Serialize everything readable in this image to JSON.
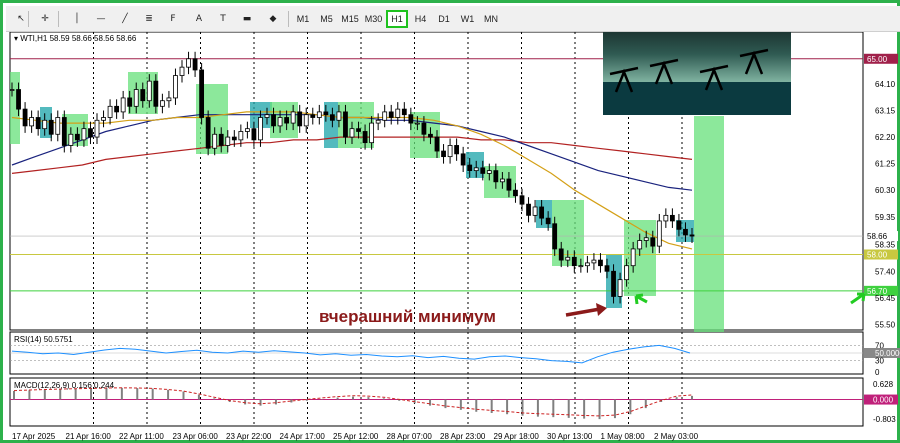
{
  "toolbar": {
    "icons": [
      "cursor-icon",
      "crosshair-icon",
      "vertical-line-icon",
      "horizontal-line-icon",
      "trend-line-icon",
      "channel-icon",
      "fibonacci-icon",
      "text-icon",
      "label-icon",
      "rectangle-icon",
      "shapes-icon"
    ],
    "timeframes": [
      "M1",
      "M5",
      "M15",
      "M30",
      "H1",
      "H4",
      "D1",
      "W1",
      "MN"
    ],
    "active_timeframe": "H1"
  },
  "header": {
    "symbol": "WTI,H1",
    "ohlc": "58.59 58.66 58.56 58.66"
  },
  "annotation": {
    "text": "вчерашний минимум",
    "color": "#8b1a1a"
  },
  "colors": {
    "bull": "#000000",
    "bear": "#000000",
    "zone_green": "#66e07a",
    "zone_teal": "#1aa3a8",
    "ma_fast": "#d4a017",
    "ma_mid": "#1a237e",
    "ma_slow": "#b22222",
    "resistance": "#a0204a",
    "level_yellow": "#c8c840",
    "level_green": "#3fd13f",
    "rsi_line": "#1e90ff",
    "macd_hist": "#808080",
    "macd_signal": "#cc2222"
  },
  "chart_data": [
    {
      "type": "line",
      "name": "price",
      "x_labels": [
        "17 Apr 2025",
        "21 Apr 16:00",
        "22 Apr 11:00",
        "23 Apr 06:00",
        "23 Apr 22:00",
        "24 Apr 17:00",
        "25 Apr 12:00",
        "28 Apr 07:00",
        "28 Apr 23:00",
        "29 Apr 18:00",
        "30 Apr 13:00",
        "1 May 08:00",
        "2 May 03:00"
      ],
      "y_ticks": [
        64.1,
        63.15,
        62.2,
        61.25,
        60.3,
        59.35,
        58.35,
        57.4,
        56.45,
        55.5
      ],
      "ylim": [
        55.3,
        65.6
      ],
      "levels": [
        {
          "value": 65.0,
          "label": "65.00",
          "color": "#a0204a"
        },
        {
          "value": 58.0,
          "label": "58.00",
          "color": "#c8c840"
        },
        {
          "value": 56.7,
          "label": "56.70",
          "color": "#3fd13f"
        },
        {
          "value": 58.66,
          "label": "58.66",
          "color": "#000000"
        }
      ],
      "candles": [
        63.9,
        63.2,
        62.6,
        62.9,
        62.5,
        62.8,
        62.3,
        62.9,
        61.9,
        62.3,
        62.1,
        62.5,
        62.2,
        62.8,
        62.9,
        63.3,
        63.1,
        63.6,
        63.3,
        63.9,
        63.5,
        64.2,
        63.3,
        63.5,
        63.6,
        64.4,
        64.7,
        65.0,
        64.6,
        62.9,
        61.8,
        62.3,
        61.9,
        62.2,
        62.1,
        62.4,
        62.5,
        62.1,
        62.9,
        63.0,
        62.6,
        62.9,
        62.7,
        63.1,
        62.6,
        63.0,
        62.9,
        63.1,
        63.0,
        62.8,
        63.1,
        62.2,
        62.5,
        62.4,
        62.0,
        62.7,
        62.8,
        63.1,
        62.9,
        63.2,
        63.0,
        62.7,
        62.7,
        62.3,
        62.2,
        61.7,
        61.5,
        61.9,
        61.6,
        61.2,
        61.0,
        61.1,
        60.9,
        61.0,
        60.6,
        60.7,
        60.3,
        60.1,
        59.8,
        59.4,
        59.7,
        59.3,
        59.1,
        58.2,
        57.8,
        57.9,
        57.6,
        57.6,
        57.7,
        57.8,
        57.6,
        57.4,
        56.5,
        57.1,
        57.6,
        58.2,
        58.5,
        58.6,
        58.3,
        59.2,
        59.4,
        59.2,
        58.9,
        58.7,
        58.66
      ],
      "ma_fast": [
        62.9,
        62.8,
        62.7,
        62.7,
        62.7,
        62.8,
        62.8,
        62.9,
        62.9,
        63.0,
        63.1,
        63.1,
        63.1,
        63.0,
        62.9,
        62.9,
        62.9,
        62.9,
        62.8,
        62.6,
        62.3,
        61.9,
        61.4,
        60.9,
        60.3,
        59.8,
        59.3,
        58.8,
        58.4,
        58.2
      ],
      "ma_mid": [
        61.2,
        61.5,
        61.8,
        62.1,
        62.4,
        62.6,
        62.8,
        62.9,
        63.0,
        63.0,
        63.0,
        63.0,
        63.0,
        63.0,
        62.9,
        62.9,
        62.8,
        62.8,
        62.7,
        62.6,
        62.4,
        62.2,
        61.9,
        61.6,
        61.3,
        61.0,
        60.8,
        60.6,
        60.4,
        60.3
      ],
      "ma_slow": [
        60.9,
        61.0,
        61.1,
        61.2,
        61.4,
        61.5,
        61.6,
        61.7,
        61.8,
        61.9,
        62.0,
        62.0,
        62.1,
        62.1,
        62.2,
        62.2,
        62.2,
        62.2,
        62.2,
        62.2,
        62.1,
        62.1,
        62.0,
        62.0,
        61.9,
        61.8,
        61.7,
        61.6,
        61.5,
        61.4
      ]
    },
    {
      "type": "line",
      "name": "RSI(14) 50.5751",
      "y_ticks": [
        70,
        50.0,
        30,
        0
      ],
      "ylim": [
        0,
        100
      ],
      "values": [
        55,
        52,
        48,
        50,
        46,
        52,
        58,
        62,
        60,
        55,
        50,
        54,
        57,
        52,
        50,
        55,
        52,
        56,
        53,
        50,
        45,
        48,
        44,
        46,
        42,
        40,
        43,
        38,
        41,
        36,
        34,
        40,
        42,
        38,
        35,
        30,
        28,
        24,
        40,
        52,
        60,
        66,
        70,
        62,
        50
      ]
    },
    {
      "type": "bar",
      "name": "MACD(12,26,9) 0.156 0.244",
      "y_ticks": [
        0.628,
        0.0,
        -0.803
      ],
      "ylim": [
        -1.0,
        0.8
      ],
      "values": [
        0.35,
        0.38,
        0.4,
        0.42,
        0.44,
        0.45,
        0.47,
        0.48,
        0.47,
        0.45,
        0.4,
        0.33,
        0.2,
        0.05,
        -0.1,
        -0.2,
        -0.25,
        -0.2,
        -0.12,
        -0.05,
        0.02,
        0.08,
        0.12,
        0.1,
        0.05,
        -0.05,
        -0.15,
        -0.25,
        -0.35,
        -0.42,
        -0.5,
        -0.55,
        -0.6,
        -0.66,
        -0.7,
        -0.72,
        -0.75,
        -0.78,
        -0.8,
        -0.76,
        -0.6,
        -0.35,
        -0.1,
        0.1,
        0.15
      ]
    }
  ]
}
